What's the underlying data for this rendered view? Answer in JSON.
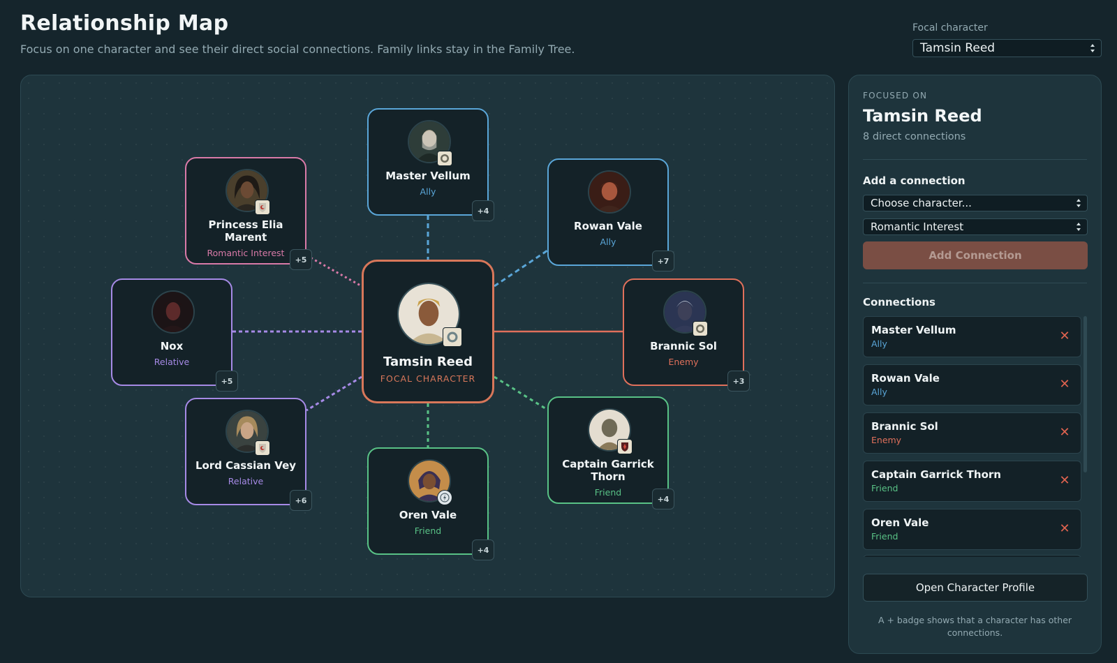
{
  "header": {
    "title": "Relationship Map",
    "subtitle": "Focus on one character and see their direct social connections. Family links stay in the Family Tree.",
    "focal_label": "Focal character",
    "focal_value": "Tamsin Reed"
  },
  "colors": {
    "ally": "#5aa6d8",
    "romantic": "#d97aa8",
    "relative": "#a68ae6",
    "enemy": "#e0705b",
    "friend": "#59c286",
    "focal": "#d8775a"
  },
  "map": {
    "focal": {
      "name": "Tamsin Reed",
      "tag": "FOCAL CHARACTER",
      "emblem": "crest-emblem-icon"
    },
    "nodes": [
      {
        "name": "Master Vellum",
        "role": "Ally",
        "kind": "ally",
        "badge": "+4",
        "emblem": "crest-emblem-icon"
      },
      {
        "name": "Rowan Vale",
        "role": "Ally",
        "kind": "ally",
        "badge": "+7",
        "emblem": ""
      },
      {
        "name": "Brannic Sol",
        "role": "Enemy",
        "kind": "enemy",
        "badge": "+3",
        "emblem": "crest-emblem-icon"
      },
      {
        "name": "Captain Garrick Thorn",
        "role": "Friend",
        "kind": "friend",
        "badge": "+4",
        "emblem": "dragon-shield-icon"
      },
      {
        "name": "Oren Vale",
        "role": "Friend",
        "kind": "friend",
        "badge": "+4",
        "emblem": "compass-icon"
      },
      {
        "name": "Lord Cassian Vey",
        "role": "Relative",
        "kind": "relative",
        "badge": "+6",
        "emblem": "red-shield-icon"
      },
      {
        "name": "Nox",
        "role": "Relative",
        "kind": "relative",
        "badge": "+5",
        "emblem": ""
      },
      {
        "name": "Princess Elia Marent",
        "role": "Romantic Interest",
        "kind": "romantic",
        "badge": "+5",
        "emblem": "red-shield-icon"
      }
    ]
  },
  "panel": {
    "focused_label": "FOCUSED ON",
    "name": "Tamsin Reed",
    "count": "8 direct connections",
    "add_title": "Add a connection",
    "character_select": "Choose character...",
    "type_select": "Romantic Interest",
    "add_button": "Add Connection",
    "connections_title": "Connections",
    "connections": [
      {
        "name": "Master Vellum",
        "role": "Ally",
        "kind": "ally"
      },
      {
        "name": "Rowan Vale",
        "role": "Ally",
        "kind": "ally"
      },
      {
        "name": "Brannic Sol",
        "role": "Enemy",
        "kind": "enemy"
      },
      {
        "name": "Captain Garrick Thorn",
        "role": "Friend",
        "kind": "friend"
      },
      {
        "name": "Oren Vale",
        "role": "Friend",
        "kind": "friend"
      }
    ],
    "remove_glyph": "✕",
    "open_button": "Open Character Profile",
    "hint": "A + badge shows that a character has other connections."
  }
}
